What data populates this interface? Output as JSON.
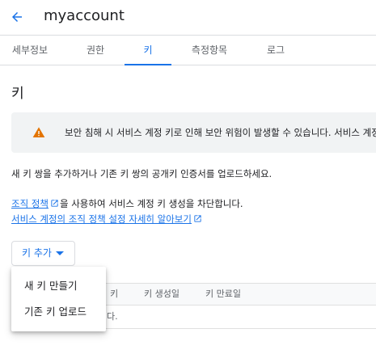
{
  "header": {
    "title": "myaccount",
    "back_icon": "arrow-back-icon"
  },
  "tabs": [
    {
      "label": "세부정보"
    },
    {
      "label": "권한"
    },
    {
      "label": "키"
    },
    {
      "label": "측정항목"
    },
    {
      "label": "로그"
    }
  ],
  "active_tab": "키",
  "section": {
    "title": "키",
    "warning": {
      "icon": "warning-icon",
      "text": "보안 침해 시 서비스 계정 키로 인해 보안 위험이 발생할 수 있습니다. 서비스 계정"
    },
    "description": "새 키 쌍을 추가하거나 기존 키 쌍의 공개키 인증서를 업로드하세요.",
    "policy_link": "조직 정책",
    "policy_text": "을 사용하여 서비스 계정 키 생성을 차단합니다.",
    "policy_learn_more": "서비스 계정의 조직 정책 설정 자세히 알아보기",
    "external_icon": "external-link-icon"
  },
  "add_key_button": {
    "label": "키 추가",
    "caret_icon": "arrow-drop-down-icon"
  },
  "menu": {
    "items": [
      {
        "label": "새 키 만들기"
      },
      {
        "label": "기존 키 업로드"
      }
    ]
  },
  "table": {
    "columns": [
      "키",
      "키 생성일",
      "키 만료일"
    ],
    "empty_text_fragment": "다."
  },
  "colors": {
    "accent": "#1a73e8",
    "warning": "#e37400",
    "text": "#202124",
    "muted": "#5f6368"
  }
}
